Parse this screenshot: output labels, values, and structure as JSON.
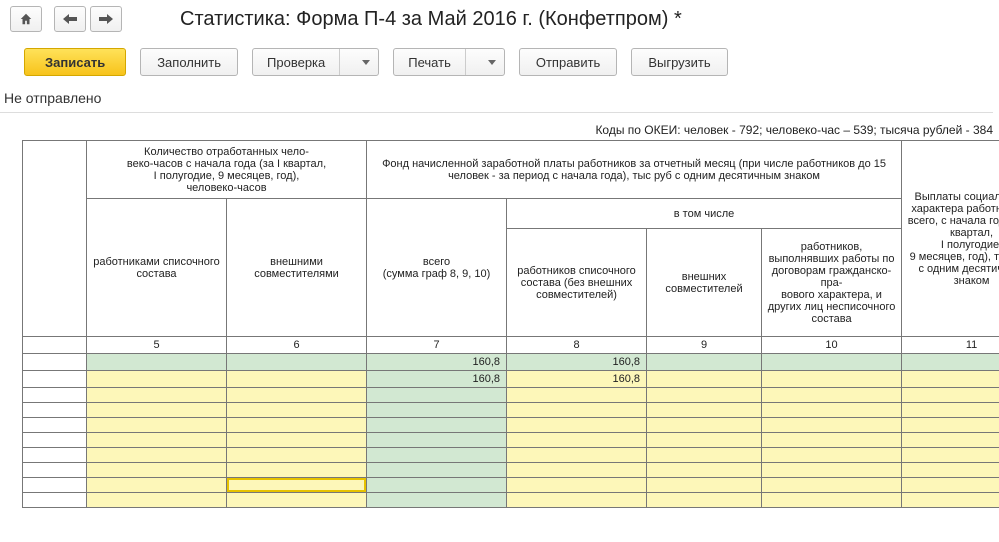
{
  "header": {
    "title": "Статистика: Форма П-4 за Май 2016 г. (Конфетпром) *"
  },
  "toolbar": {
    "save": "Записать",
    "fill": "Заполнить",
    "check": "Проверка",
    "print": "Печать",
    "send": "Отправить",
    "export": "Выгрузить"
  },
  "status": "Не отправлено",
  "codes_line": "Коды по ОКЕИ: человек - 792; человеко-час – 539; тысяча рублей - 384",
  "headers": {
    "grp5_6": "Количество отработанных чело-\nвеко-часов с начала года (за I квартал,\nI полугодие, 9 месяцев, год),\nчеловеко-часов",
    "col5": "работниками списочного состава",
    "col6": "внешними совместителями",
    "grp7_10": "Фонд начисленной заработной платы работников за отчетный месяц (при числе работников до 15 человек - за период с начала года), тыс руб с одним десятичным знаком",
    "col7": "всего\n(сумма граф 8, 9, 10)",
    "grp8_10": "в том числе",
    "col8": "работников списочного состава (без внешних совместителей)",
    "col9": "внешних совместителей",
    "col10": "работников, выполнявших работы по договорам гражданско-пра-\nвового характера, и других лиц несписочного состава",
    "col11": "Выплаты социального характера работников - всего, с начала года (за I квартал,\nI полугодие,\n9 месяцев, год), тыс руб с одним десятичным знаком"
  },
  "colnums": {
    "c5": "5",
    "c6": "6",
    "c7": "7",
    "c8": "8",
    "c9": "9",
    "c10": "10",
    "c11": "11"
  },
  "data": {
    "r1c7": "160,8",
    "r1c8": "160,8",
    "r2c7": "160,8",
    "r2c8": "160,8"
  }
}
